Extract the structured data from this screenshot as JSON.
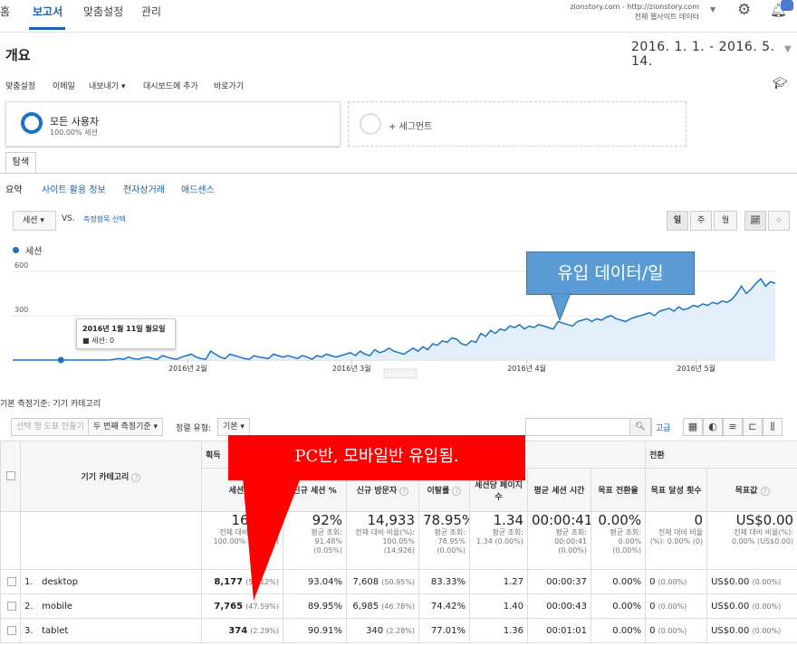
{
  "nav": {
    "home_partial": "홈",
    "tabs": [
      "보고서",
      "맞춤설정",
      "관리"
    ],
    "account_line1": "zionstory.com - http://zionstory.com",
    "account_line2": "전체 웹사이트 데이터"
  },
  "page": {
    "title": "개요",
    "date_range": "2016. 1. 1. - 2016. 5. 14."
  },
  "toolbar": [
    "맞춤설정",
    "이메일",
    "내보내기 ▾",
    "대시보드에 추가",
    "바로가기"
  ],
  "segments": {
    "active_name": "모든 사용자",
    "active_sub": "100.00% 세션",
    "add_label": "+ 세그먼트"
  },
  "explore_tab": "탐색",
  "subtabs": [
    "요약",
    "사이트 활용 정보",
    "전자상거래",
    "애드센스"
  ],
  "chart_controls": {
    "metric": "세션 ▾",
    "vs": "VS.",
    "compare": "측정항목 선택",
    "day": "일",
    "week": "주",
    "month": "월"
  },
  "chart_data": {
    "type": "area",
    "legend": "세션",
    "ylim": [
      0,
      600
    ],
    "yticks": [
      "600",
      "300"
    ],
    "xticks": [
      "2016년 2월",
      "2016년 3월",
      "2016년 4월",
      "2016년 5월"
    ],
    "values": [
      0,
      0,
      0,
      0,
      0,
      0,
      0,
      0,
      0,
      0,
      0,
      0,
      0,
      0,
      0,
      0,
      0,
      0,
      0,
      0,
      0,
      5,
      10,
      5,
      20,
      10,
      5,
      15,
      20,
      10,
      5,
      30,
      20,
      10,
      5,
      20,
      30,
      40,
      20,
      10,
      5,
      60,
      40,
      20,
      10,
      40,
      30,
      20,
      10,
      5,
      30,
      20,
      15,
      10,
      40,
      30,
      20,
      30,
      20,
      10,
      30,
      20,
      5,
      30,
      20,
      40,
      30,
      20,
      30,
      40,
      50,
      30,
      60,
      40,
      30,
      70,
      50,
      60,
      80,
      60,
      50,
      40,
      60,
      80,
      60,
      90,
      70,
      110,
      100,
      130,
      120,
      150,
      140,
      110,
      100,
      130,
      120,
      180,
      160,
      200,
      180,
      210,
      200,
      230,
      220,
      240,
      210,
      230,
      220,
      240,
      230,
      220,
      210,
      260,
      250,
      240,
      230,
      260,
      270,
      280,
      260,
      280,
      270,
      290,
      300,
      280,
      270,
      260,
      280,
      290,
      300,
      310,
      320,
      300,
      330,
      340,
      350,
      330,
      360,
      340,
      350,
      370,
      360,
      380,
      370,
      390,
      380,
      400,
      390,
      410,
      450,
      500,
      450,
      480,
      520,
      550,
      500,
      530,
      520
    ]
  },
  "tooltip": {
    "date": "2016년 1월 11일 월요일",
    "value": "■ 세션: 0"
  },
  "callout1": "유입 데이터/일",
  "callout2": "PC반, 모바일반 유입됨.",
  "table_controls": {
    "primary_dimension": "기본 측정기준: 기기 카테고리",
    "plot_rows": "선택 행 도표 만들기",
    "secondary_dimension": "두 번째 측정기준 ▾",
    "sort_type_label": "정렬 유형:",
    "sort_type": "기본 ▾",
    "advanced": "고급"
  },
  "table": {
    "group_acquisition": "획득",
    "group_conversion": "전환",
    "dim_header": "기기 카테고리",
    "columns": [
      "세션",
      "신규 세션 %",
      "신규 방문자",
      "이탈률",
      "세션당 페이지수",
      "평균 세션 시간",
      "목표 전환율",
      "목표 달성 횟수",
      "목표값"
    ],
    "totals": {
      "sessions": "16,316",
      "sessions_sub": "전체 대비 비율(%): 100.00% (16,316)",
      "new_pct": "92%",
      "new_pct_sub": "평균 조회: 91.48% (0.05%)",
      "new_users": "14,933",
      "new_users_sub": "전체 대비 비율(%): 100.05% (14,926)",
      "bounce": "78.95%",
      "bounce_sub": "평균 조회: 78.95% (0.00%)",
      "pages": "1.34",
      "pages_sub": "평균 조회: 1.34 (0.00%)",
      "duration": "00:00:41",
      "duration_sub": "평균 조회: 00:00:41 (0.00%)",
      "conv": "0.00%",
      "conv_sub": "평균 조회: 0.00% (0.00%)",
      "goals": "0",
      "goals_sub": "전체 대비 비율(%): 0.00% (0)",
      "value": "US$0.00",
      "value_sub": "전체 대비 비율(%): 0.00% (US$0.00)"
    },
    "rows": [
      {
        "idx": "1.",
        "name": "desktop",
        "sessions": "8,177",
        "sessions_pct": "(50.12%)",
        "new_pct": "93.04%",
        "new_users": "7,608",
        "new_users_pct": "(50.95%)",
        "bounce": "83.33%",
        "pages": "1.27",
        "duration": "00:00:37",
        "conv": "0.00%",
        "goals": "0",
        "goals_pct": "(0.00%)",
        "value": "US$0.00",
        "value_pct": "(0.00%)"
      },
      {
        "idx": "2.",
        "name": "mobile",
        "sessions": "7,765",
        "sessions_pct": "(47.59%)",
        "new_pct": "89.95%",
        "new_users": "6,985",
        "new_users_pct": "(46.78%)",
        "bounce": "74.42%",
        "pages": "1.40",
        "duration": "00:00:43",
        "conv": "0.00%",
        "goals": "0",
        "goals_pct": "(0.00%)",
        "value": "US$0.00",
        "value_pct": "(0.00%)"
      },
      {
        "idx": "3.",
        "name": "tablet",
        "sessions": "374",
        "sessions_pct": "(2.29%)",
        "new_pct": "90.91%",
        "new_users": "340",
        "new_users_pct": "(2.28%)",
        "bounce": "77.01%",
        "pages": "1.36",
        "duration": "00:01:01",
        "conv": "0.00%",
        "goals": "0",
        "goals_pct": "(0.00%)",
        "value": "US$0.00",
        "value_pct": "(0.00%)"
      }
    ]
  },
  "colors": {
    "accent": "#1a73c8",
    "callout_blue": "#5b9bd5",
    "callout_red": "#ff0000"
  }
}
